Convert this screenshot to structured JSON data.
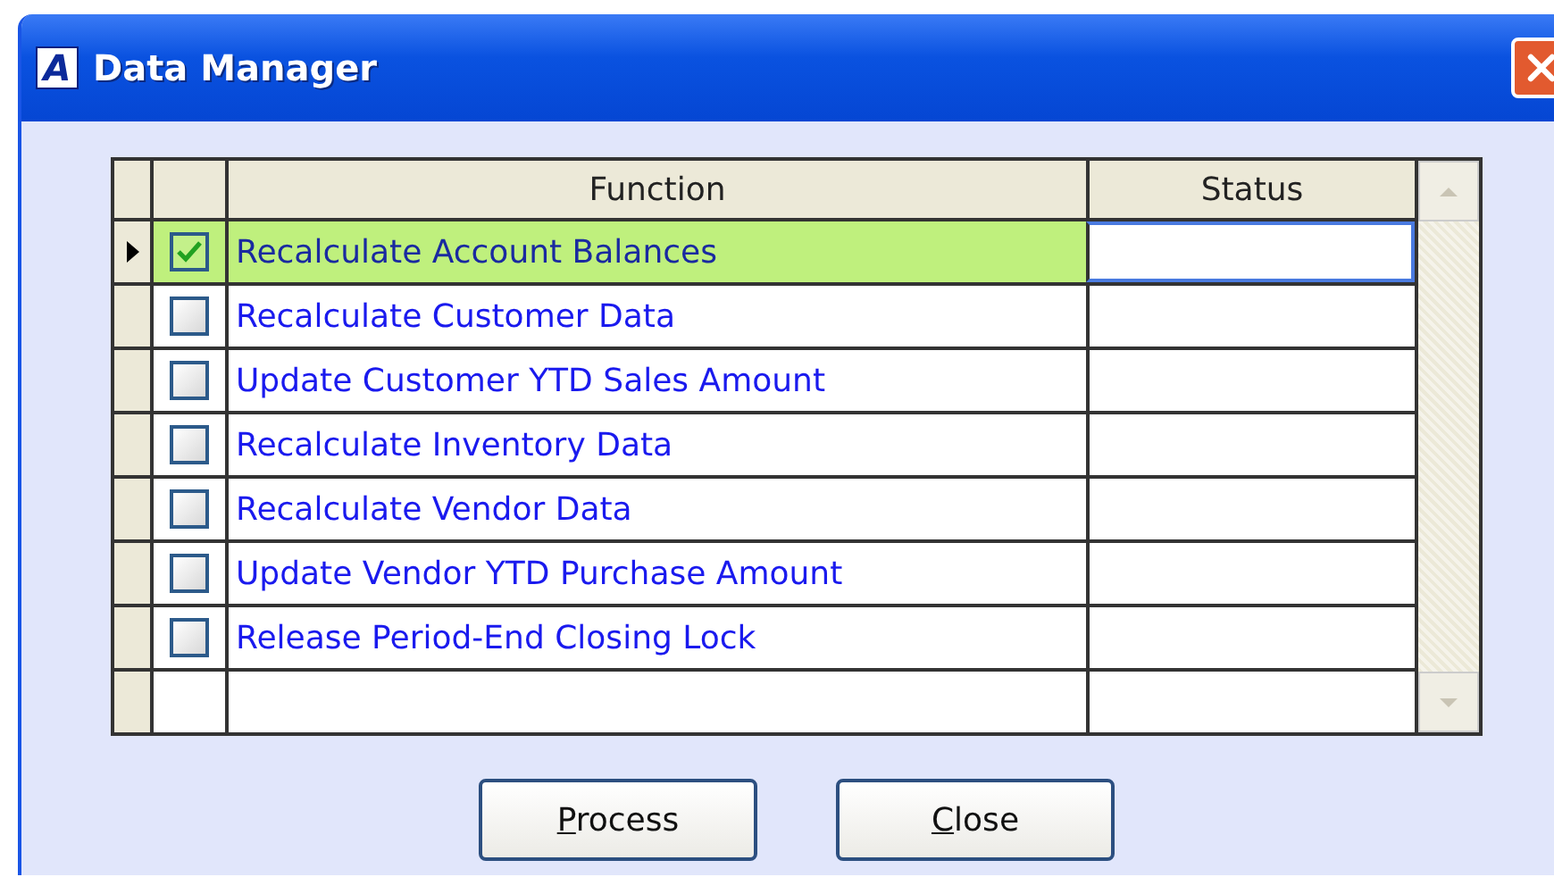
{
  "window": {
    "icon_letter": "A",
    "title": "Data Manager"
  },
  "table": {
    "columns": [
      "Function",
      "Status"
    ],
    "rows": [
      {
        "function": "Recalculate Account Balances",
        "status_cell": "",
        "checked": true,
        "selected": true
      },
      {
        "function": "Recalculate Customer Data",
        "checked": false,
        "selected": false
      },
      {
        "function": "Update Customer YTD Sales Amount",
        "checked": false,
        "selected": false
      },
      {
        "function": "Recalculate Inventory Data",
        "checked": false,
        "selected": false
      },
      {
        "function": "Recalculate Vendor Data",
        "checked": false,
        "selected": false
      },
      {
        "function": "Update Vendor YTD Purchase Amount",
        "checked": false,
        "selected": false
      },
      {
        "function": "Release Period-End Closing Lock",
        "checked": false,
        "selected": false
      }
    ]
  },
  "buttons": [
    {
      "label": "Process",
      "underline_first": true
    },
    {
      "label": "Close",
      "underline_first": true
    }
  ]
}
